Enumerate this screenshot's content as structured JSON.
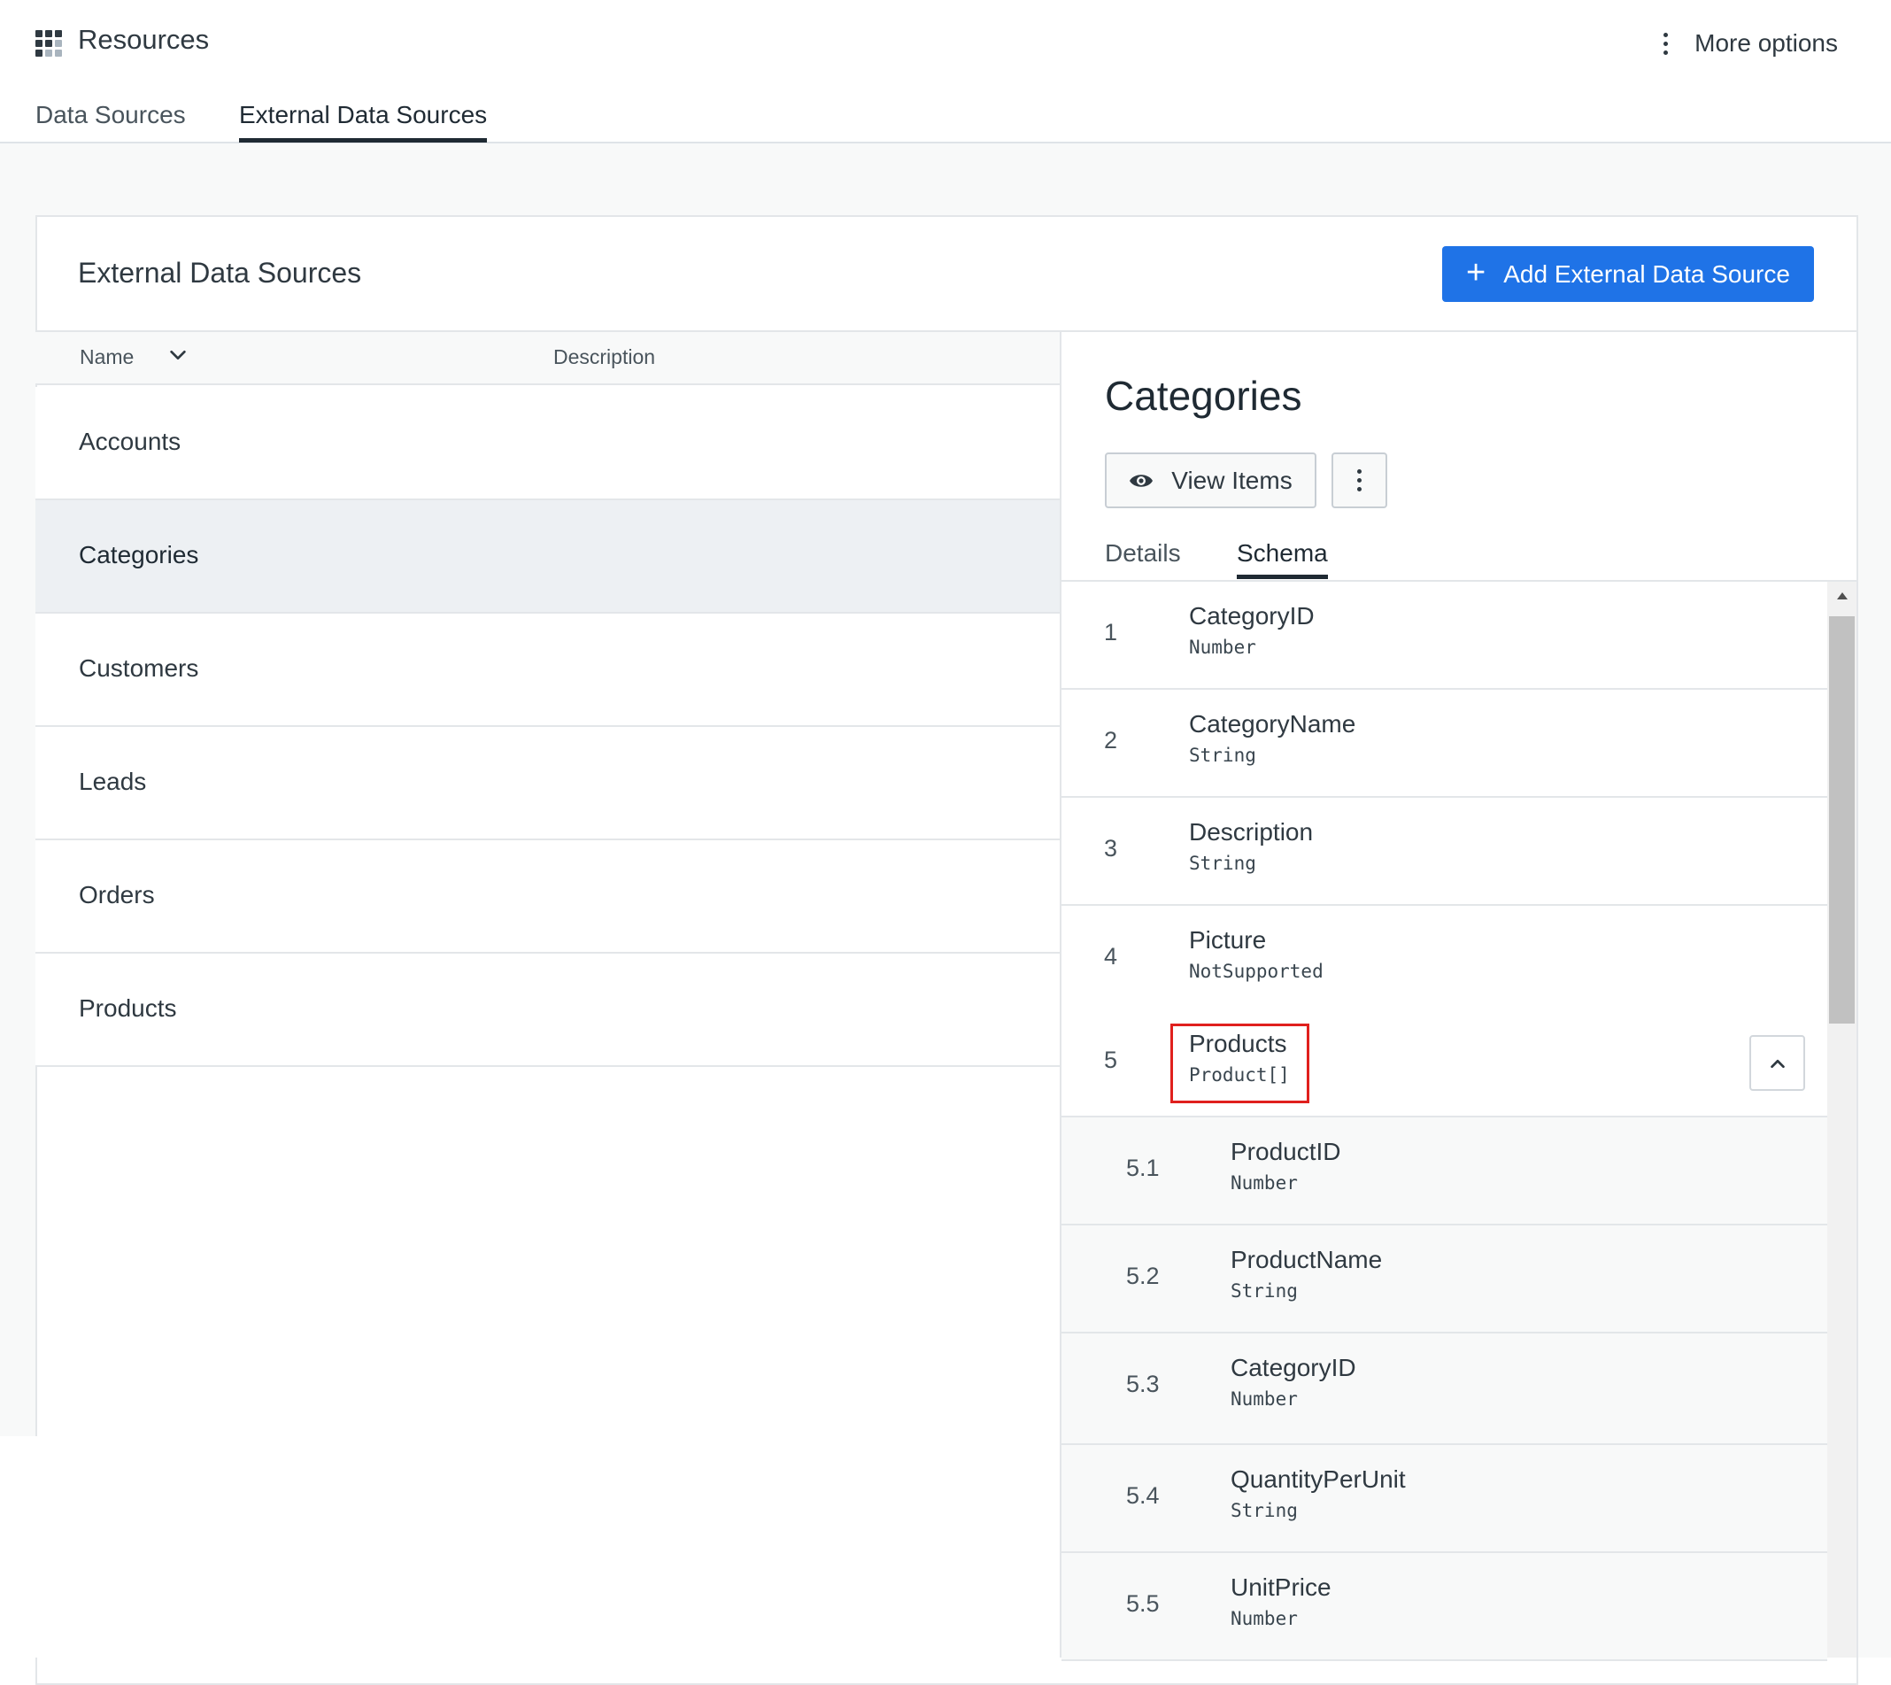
{
  "app": {
    "title": "Resources",
    "icon": "grid-icon",
    "more_options_label": "More options"
  },
  "top_tabs": [
    {
      "label": "Data Sources",
      "active": false
    },
    {
      "label": "External Data Sources",
      "active": true
    }
  ],
  "panel": {
    "title": "External Data Sources",
    "add_button_label": "Add External Data Source",
    "accent_color": "#1f73e7"
  },
  "list": {
    "columns": {
      "name": "Name",
      "description": "Description"
    },
    "rows": [
      {
        "name": "Accounts",
        "selected": false
      },
      {
        "name": "Categories",
        "selected": true
      },
      {
        "name": "Customers",
        "selected": false
      },
      {
        "name": "Leads",
        "selected": false
      },
      {
        "name": "Orders",
        "selected": false
      },
      {
        "name": "Products",
        "selected": false
      }
    ]
  },
  "detail": {
    "title": "Categories",
    "view_items_label": "View Items",
    "tabs": [
      {
        "label": "Details",
        "active": false
      },
      {
        "label": "Schema",
        "active": true
      }
    ],
    "schema": [
      {
        "num": "1",
        "name": "CategoryID",
        "type": "Number"
      },
      {
        "num": "2",
        "name": "CategoryName",
        "type": "String"
      },
      {
        "num": "3",
        "name": "Description",
        "type": "String"
      },
      {
        "num": "4",
        "name": "Picture",
        "type": "NotSupported"
      },
      {
        "num": "5",
        "name": "Products",
        "type": "Product[]",
        "expanded": true,
        "highlighted": true,
        "children": [
          {
            "num": "5.1",
            "name": "ProductID",
            "type": "Number"
          },
          {
            "num": "5.2",
            "name": "ProductName",
            "type": "String"
          },
          {
            "num": "5.3",
            "name": "CategoryID",
            "type": "Number"
          },
          {
            "num": "5.4",
            "name": "QuantityPerUnit",
            "type": "String"
          },
          {
            "num": "5.5",
            "name": "UnitPrice",
            "type": "Number"
          }
        ]
      }
    ],
    "highlight_color": "#e0201e"
  }
}
